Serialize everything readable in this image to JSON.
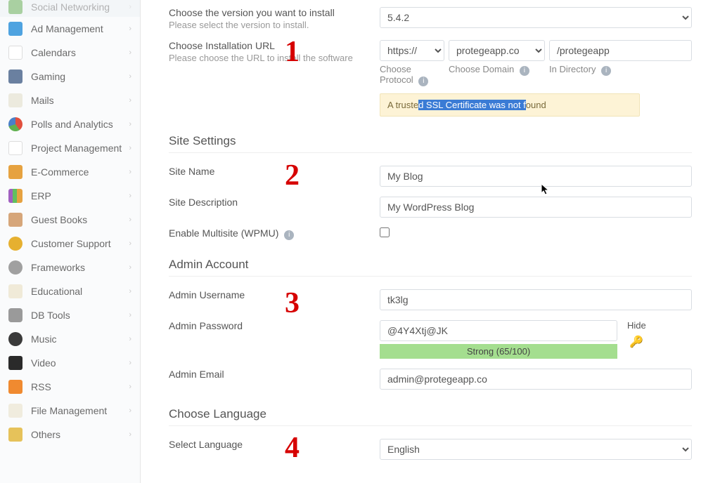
{
  "sidebar": {
    "items": [
      {
        "label": "Social Networking",
        "color": "#5aa648"
      },
      {
        "label": "Ad Management",
        "color": "#4fa3e0"
      },
      {
        "label": "Calendars",
        "color": "#e6a840"
      },
      {
        "label": "Gaming",
        "color": "#6a80a0"
      },
      {
        "label": "Mails",
        "color": "#d6d4c8"
      },
      {
        "label": "Polls and Analytics",
        "color": "#e14f3d"
      },
      {
        "label": "Project Management",
        "color": "#6aa8e0"
      },
      {
        "label": "E-Commerce",
        "color": "#e6a240"
      },
      {
        "label": "ERP",
        "color": "#a060c0"
      },
      {
        "label": "Guest Books",
        "color": "#d6a67a"
      },
      {
        "label": "Customer Support",
        "color": "#e6b030"
      },
      {
        "label": "Frameworks",
        "color": "#a0a0a0"
      },
      {
        "label": "Educational",
        "color": "#d6c8a0"
      },
      {
        "label": "DB Tools",
        "color": "#9a9a9a"
      },
      {
        "label": "Music",
        "color": "#3a3a3a"
      },
      {
        "label": "Video",
        "color": "#2a2a2a"
      },
      {
        "label": "RSS",
        "color": "#f08a30"
      },
      {
        "label": "File Management",
        "color": "#d8d4c8"
      },
      {
        "label": "Others",
        "color": "#e6c25a"
      }
    ]
  },
  "version": {
    "label": "Choose the version you want to install",
    "sub": "Please select the version to install.",
    "value": "5.4.2"
  },
  "install_url": {
    "label": "Choose Installation URL",
    "sub": "Please choose the URL to install the software",
    "protocol": "https://",
    "protocol_label": "Choose Protocol",
    "domain": "protegeapp.co",
    "domain_label": "Choose Domain",
    "directory": "/protegeapp",
    "directory_label": "In Directory"
  },
  "ssl_warning": {
    "pre": "A truste",
    "highlighted": "d SSL Certificate was not f",
    "post": "ound"
  },
  "site_settings": {
    "heading": "Site Settings",
    "name_label": "Site Name",
    "name_value": "My Blog",
    "desc_label": "Site Description",
    "desc_value": "My WordPress Blog",
    "multisite_label": "Enable Multisite (WPMU)"
  },
  "admin": {
    "heading": "Admin Account",
    "user_label": "Admin Username",
    "user_value": "tk3lg",
    "pass_label": "Admin Password",
    "pass_value": "@4Y4Xtj@JK",
    "strength_text": "Strong (65/100)",
    "hide_label": "Hide",
    "email_label": "Admin Email",
    "email_value": "admin@protegeapp.co"
  },
  "language": {
    "heading": "Choose Language",
    "label": "Select Language",
    "value": "English"
  },
  "annotations": {
    "n1": "1",
    "n2": "2",
    "n3": "3",
    "n4": "4"
  }
}
